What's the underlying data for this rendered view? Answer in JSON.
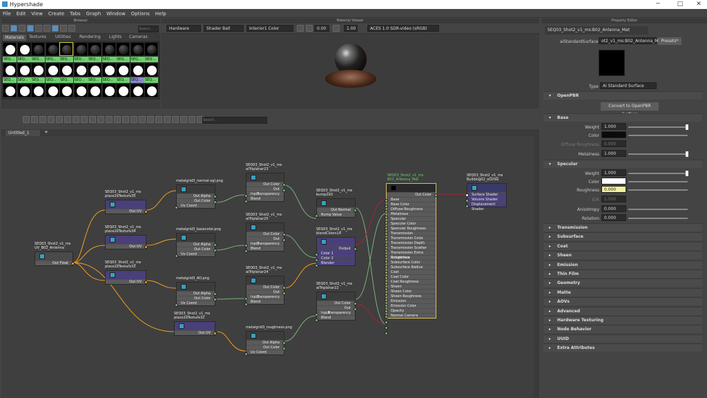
{
  "window": {
    "title": "Hypershade",
    "min": "─",
    "max": "□",
    "close": "✕"
  },
  "menu": [
    "File",
    "Edit",
    "View",
    "Create",
    "Tabs",
    "Graph",
    "Window",
    "Options",
    "Help"
  ],
  "browser": {
    "title": "Browser",
    "search_placeholder": "Search...",
    "tabs": [
      "Materials",
      "Textures",
      "Utilities",
      "Rendering",
      "Lights",
      "Cameras"
    ],
    "swatch_label": "SEQ..."
  },
  "viewer": {
    "title": "Material Viewer",
    "renderer": "Hardware",
    "geometry": "Shader Ball",
    "environment": "Interior1 Color",
    "exposure": "0.00",
    "gamma": "1.00",
    "colorspace": "ACES 1.0 SDR-video (sRGB)"
  },
  "graph": {
    "tab": "Untitled_1",
    "add_tab": "+",
    "search_placeholder": "Search..."
  },
  "nodes": [
    {
      "title": "SEQ03_Shot2_v1_ms\nUV_B02_Antenna",
      "rows": [
        "Out Float"
      ]
    },
    {
      "title": "SEQ03_Shot2_v1_ms\nplace2dTexture35",
      "rows": [
        "Out UV"
      ]
    },
    {
      "title": "SEQ03_Shot2_v1_ms\nplace2dTexture34",
      "rows": [
        "Out UV"
      ]
    },
    {
      "title": "SEQ03_Shot2_v1_ms\nplace2dTexture33",
      "rows": [
        "Out UV"
      ]
    },
    {
      "title": "SEQ03_Shot2_v1_ms\nplace2dTexture32",
      "rows": [
        "Out UV"
      ]
    },
    {
      "title": "metalgrid3_normal-ogl.png",
      "rows": [
        "Out Alpha",
        "Out Color",
        "Uv Coord"
      ]
    },
    {
      "title": "metalgrid3_basecolor.png",
      "rows": [
        "Out Alpha",
        "Out Color",
        "Uv Coord"
      ]
    },
    {
      "title": "metalgrid3_AO.png",
      "rows": [
        "Out Alpha",
        "Out Color",
        "Uv Coord"
      ]
    },
    {
      "title": "metalgrid3_roughness.png",
      "rows": [
        "Out Alpha",
        "Out Color",
        "Uv Coord"
      ]
    },
    {
      "title": "SEQ03_Shot2_v1_ms\naiTriplanar23",
      "rows": [
        "Out Color",
        "Out Transparency",
        "Input",
        "Blend"
      ]
    },
    {
      "title": "SEQ03_Shot2_v1_ms\naiTriplanar25",
      "rows": [
        "Out Color",
        "Out Transparency",
        "Input",
        "Blend"
      ]
    },
    {
      "title": "SEQ03_Shot2_v1_ms\naiTriplanar24",
      "rows": [
        "Out Color",
        "Out Transparency",
        "Input",
        "Blend"
      ]
    },
    {
      "title": "SEQ03_Shot2_v1_ms\nbump2d3",
      "rows": [
        "Out Normal",
        "Bump Value"
      ]
    },
    {
      "title": "SEQ03_Shot2_v1_ms\nblendColors14",
      "rows": [
        "Output",
        "Color 1",
        "Color 2",
        "Blender"
      ]
    },
    {
      "title": "SEQ03_Shot2_v1_ms\naiTriplanar22",
      "rows": [
        "Out Color",
        "Out Transparency",
        "Input",
        "Blend"
      ]
    },
    {
      "title": "SEQ03_Shot2_v1_ms\nB02_Antenna_Mat",
      "rows": [
        "Out Color",
        "Base",
        "Base Color",
        "Diffuse Roughness",
        "Metalness",
        "Specular",
        "Specular Color",
        "Specular Roughness",
        "Transmission",
        "Transmission Color",
        "Transmission Depth",
        "Transmission Scatter",
        "Transmission Extra Roughness",
        "Subsurface",
        "Subsurface Color",
        "Subsurface Radius",
        "Coat",
        "Coat Color",
        "Coat Roughness",
        "Sheen",
        "Sheen Color",
        "Sheen Roughness",
        "Emission",
        "Emission Color",
        "Opacity",
        "Normal Camera"
      ]
    },
    {
      "title": "SEQ03_Shot2_v1_ms\nBuilding02_oO2SG",
      "rows": [
        "Surface Shader",
        "Volume Shader",
        "Displacement Shader"
      ]
    }
  ],
  "property": {
    "title": "Property Editor",
    "node": "SEQ03_Shot2_v1_ms:B02_Antenna_Mat",
    "type_label": "aiStandardSurface:",
    "type_value": "ot2_v1_ms:B02_Antenna_Mat",
    "presets": "Presets*",
    "type_field_label": "Type",
    "type_field_value": "Ai Standard Surface",
    "openpbr": "OpenPBR",
    "convert_btn": "Convert to OpenPBR Surface",
    "base": {
      "title": "Base",
      "weight_l": "Weight",
      "weight": "1.000",
      "color_l": "Color",
      "diff_l": "Diffuse Roughness",
      "diff": "0.000",
      "metal_l": "Metalness",
      "metal": "1.000"
    },
    "spec": {
      "title": "Specular",
      "weight_l": "Weight",
      "weight": "1.000",
      "color_l": "Color",
      "rough_l": "Roughness",
      "rough": "0.000",
      "ior_l": "IOR",
      "ior": "1.500",
      "aniso_l": "Anisotropy",
      "aniso": "0.000",
      "rot_l": "Rotation",
      "rot": "0.000"
    },
    "sections": [
      "Transmission",
      "Subsurface",
      "Coat",
      "Sheen",
      "Emission",
      "Thin Film",
      "Geometry",
      "Matte",
      "AOVs",
      "Advanced",
      "Hardware Texturing",
      "Node Behavior",
      "UUID",
      "Extra Attributes"
    ]
  },
  "colors": {
    "accent": "#5a8fbf",
    "material_border": "#d8c05a",
    "selected_green": "#6ad26a"
  }
}
